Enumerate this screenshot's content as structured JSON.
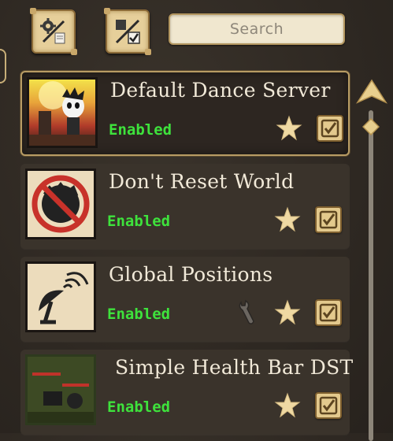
{
  "toolbar": {
    "search_placeholder": "Search"
  },
  "mods": [
    {
      "title": "Default Dance Server",
      "status": "Enabled",
      "favorite": true,
      "enabled": true,
      "selected": true
    },
    {
      "title": "Don't Reset World",
      "status": "Enabled",
      "favorite": true,
      "enabled": true,
      "selected": false
    },
    {
      "title": "Global Positions",
      "status": "Enabled",
      "favorite": true,
      "enabled": true,
      "selected": false,
      "has_config": true
    },
    {
      "title": "Simple Health Bar DST",
      "status": "Enabled",
      "favorite": true,
      "enabled": true,
      "selected": false
    }
  ],
  "colors": {
    "background": "#2f2923",
    "status_enabled": "#3ee23c",
    "button_face": "#e6cf9a",
    "frame_gold": "#b89c64"
  },
  "icons": [
    "configure-mods-icon",
    "toggle-all-icon",
    "star-icon",
    "checkbox-icon",
    "wrench-icon",
    "scroll-up-icon"
  ]
}
